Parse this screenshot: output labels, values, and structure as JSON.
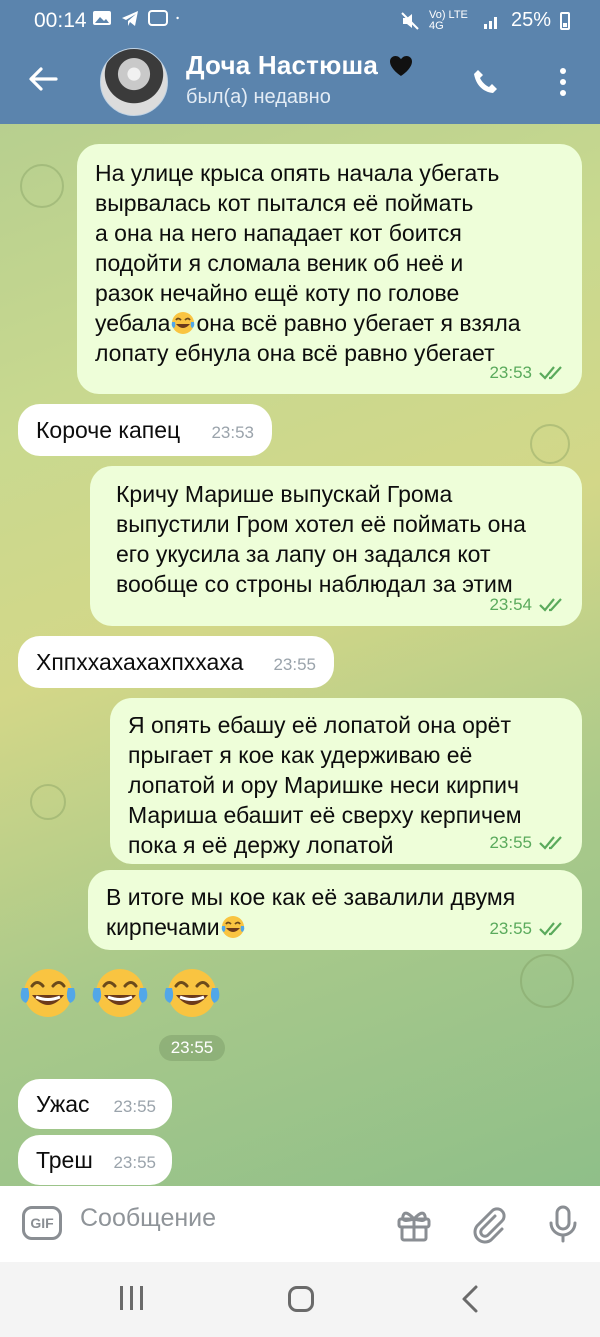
{
  "status_bar": {
    "time": "00:14",
    "network": "Vo) LTE 4G",
    "battery": "25%"
  },
  "header": {
    "title": "Доча Настюша",
    "status": "был(а) недавно"
  },
  "messages": [
    {
      "dir": "out",
      "text": "На улице крыса опять начала убегать\nвырвалась кот пытался её поймать\nа она на него нападает кот боится\nподойти я сломала веник об неё и\nразок нечайно ещё коту по голове\nуебала",
      "text_after": "она всё равно убегает я взяла\nлопату ебнула она всё равно убегает",
      "time": "23:53"
    },
    {
      "dir": "in",
      "text": "Короче капец",
      "time": "23:53"
    },
    {
      "dir": "out",
      "text": "Кричу Марише выпускай Грома\nвыпустили Гром хотел её поймать она\nего укусила за лапу он задался кот\nвообще со строны наблюдал за этим",
      "time": "23:54"
    },
    {
      "dir": "in",
      "text": "Хппххахахахпххаха",
      "time": "23:55"
    },
    {
      "dir": "out",
      "text": "Я опять ебашу её лопатой она орёт\nпрыгает я кое как удерживаю её\nлопатой и ору Маришке неси кирпич\nМариша ебашит её сверху керпичем\nпока я её держу лопатой",
      "time": "23:55"
    },
    {
      "dir": "out",
      "text": "В итоге мы кое как её завалили двумя\nкирпечами",
      "time": "23:55"
    },
    {
      "dir": "in",
      "text": "Ужас",
      "time": "23:55"
    },
    {
      "dir": "in",
      "text": "Треш",
      "time": "23:55"
    }
  ],
  "emoji_message": {
    "emoji": [
      "😂",
      "😂",
      "😂"
    ],
    "time": "23:55"
  },
  "input": {
    "placeholder": "Сообщение",
    "gif_label": "GIF"
  },
  "colors": {
    "header": "#5b84ad",
    "outgoing_bubble": "#eefed9",
    "incoming_bubble": "#ffffff",
    "check_green": "#5aaa5c"
  }
}
